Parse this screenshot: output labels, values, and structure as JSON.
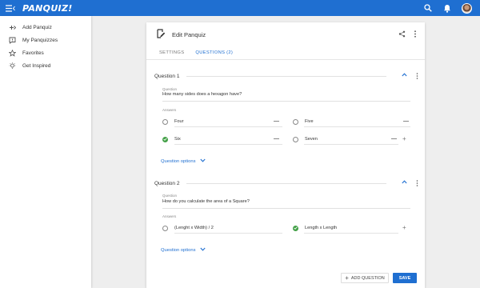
{
  "app": {
    "logo": "PANQUIZ!"
  },
  "sidebar": {
    "items": [
      {
        "label": "Add Panquiz",
        "icon": "add-panquiz-icon"
      },
      {
        "label": "My Panquizzes",
        "icon": "panquizzes-icon"
      },
      {
        "label": "Favorites",
        "icon": "star-icon"
      },
      {
        "label": "Get Inspired",
        "icon": "lightbulb-icon"
      }
    ]
  },
  "editor": {
    "title": "Edit Panquiz",
    "tabs": [
      {
        "label": "SETTINGS",
        "active": false
      },
      {
        "label": "QUESTIONS (2)",
        "active": true
      }
    ],
    "questions": [
      {
        "title": "Question 1",
        "question_label": "Question",
        "question_text": "How many sides does a hexagon have?",
        "answers_label": "Answers",
        "answers": [
          {
            "text": "Four",
            "correct": false
          },
          {
            "text": "Five",
            "correct": false
          },
          {
            "text": "Six",
            "correct": true
          },
          {
            "text": "Seven",
            "correct": false
          }
        ],
        "options_label": "Question options"
      },
      {
        "title": "Question 2",
        "question_label": "Question",
        "question_text": "How do you calculate the area of a Square?",
        "answers_label": "Answers",
        "answers": [
          {
            "text": "(Lenght x Width) / 2",
            "correct": false
          },
          {
            "text": "Length x Length",
            "correct": true
          }
        ],
        "options_label": "Question options"
      }
    ],
    "add_question_label": "ADD QUESTION",
    "save_label": "SAVE"
  },
  "colors": {
    "brand": "#1f6fd1",
    "correct": "#43a047",
    "background": "#eeeeee"
  }
}
